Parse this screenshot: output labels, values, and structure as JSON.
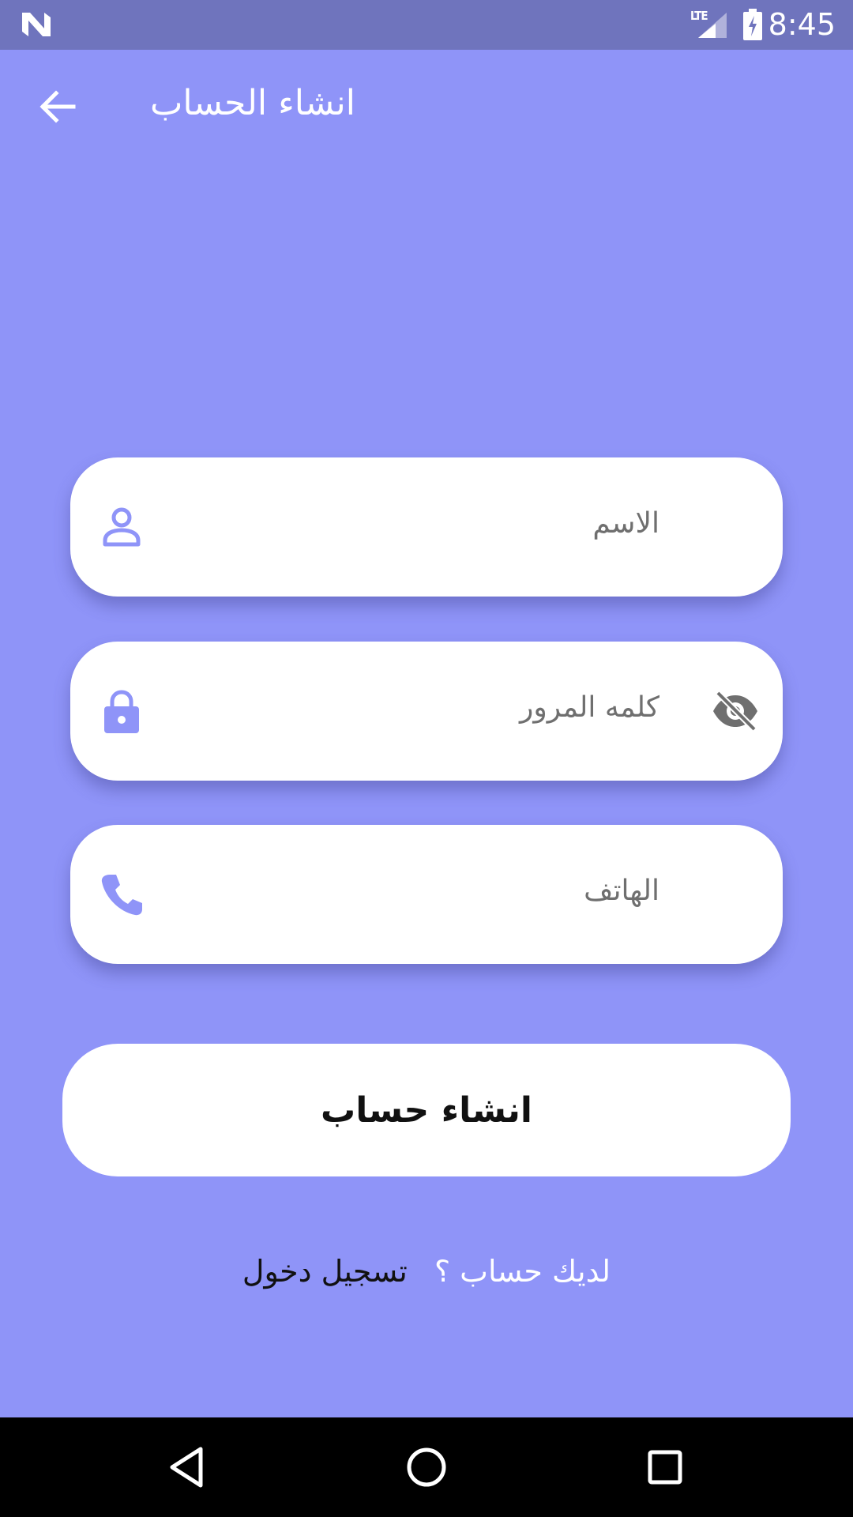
{
  "status_bar": {
    "network_label": "LTE",
    "time": "8:45",
    "icons": [
      "n-logo-icon",
      "signal-icon",
      "battery-charging-icon"
    ]
  },
  "app_bar": {
    "title": "انشاء الحساب",
    "back_icon": "arrow-back-icon"
  },
  "form": {
    "name": {
      "placeholder": "الاسم",
      "value": "",
      "icon": "person-icon"
    },
    "password": {
      "placeholder": "كلمه المرور",
      "value": "",
      "icon": "lock-icon",
      "toggle_icon": "eye-off-icon"
    },
    "phone": {
      "placeholder": "الهاتف",
      "value": "",
      "icon": "phone-icon"
    },
    "submit_label": "انشاء حساب"
  },
  "login_prompt": {
    "text": "لديك حساب ؟",
    "link": "تسجيل دخول"
  },
  "nav_bar": {
    "icons": [
      "nav-back-icon",
      "nav-home-icon",
      "nav-recent-icon"
    ]
  },
  "colors": {
    "background": "#8f94f8",
    "status_bar": "#6f74bd",
    "accent": "#8f94f8",
    "field_bg": "#ffffff",
    "nav_bar": "#000000"
  }
}
